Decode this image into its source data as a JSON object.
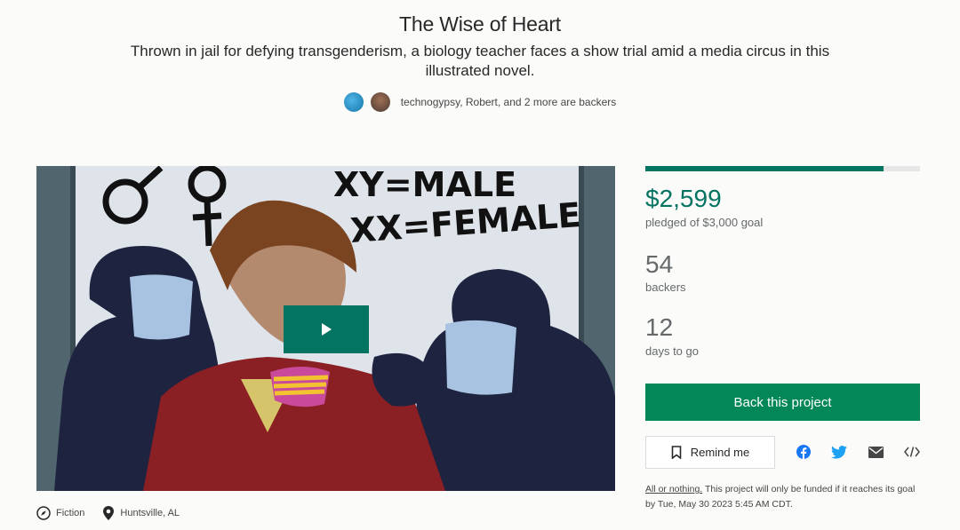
{
  "project": {
    "title": "The Wise of Heart",
    "blurb": "Thrown in jail for defying transgenderism, a biology teacher faces a show trial amid a media circus in this illustrated novel.",
    "backers_line": "technogypsy, Robert, and 2 more are backers"
  },
  "artwork": {
    "board_line1": "XY=MALE",
    "board_line2": "XX=FEMALE"
  },
  "meta": {
    "category": "Fiction",
    "location": "Huntsville, AL"
  },
  "stats": {
    "funded_fraction": 0.8663,
    "pledged": "$2,599",
    "pledged_label": "pledged of $3,000 goal",
    "backers": "54",
    "backers_label": "backers",
    "days": "12",
    "days_label": "days to go"
  },
  "actions": {
    "back_label": "Back this project",
    "remind_label": "Remind me"
  },
  "share_icons": [
    "facebook-icon",
    "twitter-icon",
    "email-icon",
    "embed-icon"
  ],
  "fine_print": {
    "link": "All or nothing.",
    "text": " This project will only be funded if it reaches its goal by Tue, May 30 2023 5:45 AM CDT."
  },
  "colors": {
    "accent_green": "#037362",
    "button_green": "#028858",
    "facebook": "#1877f2",
    "twitter": "#1da1f2"
  }
}
